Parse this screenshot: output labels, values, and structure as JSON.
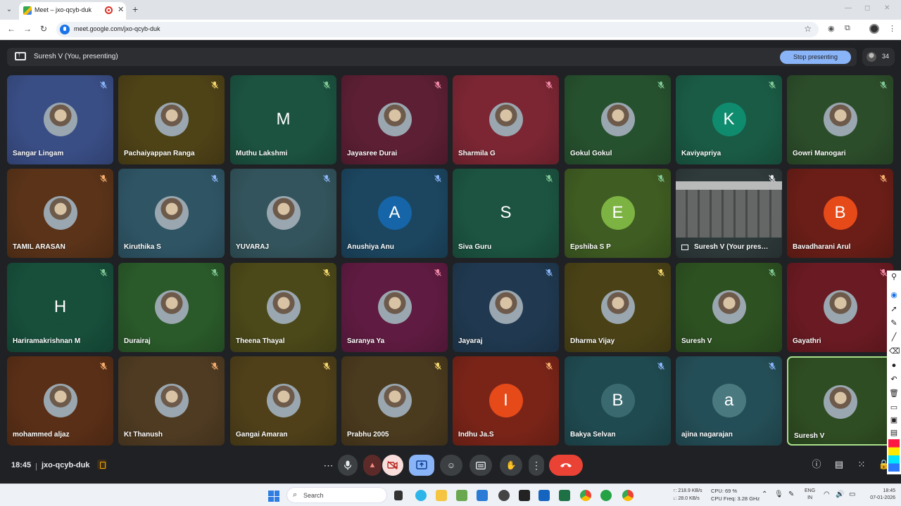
{
  "browser": {
    "tab_title": "Meet – jxo-qcyb-duk",
    "url": "meet.google.com/jxo-qcyb-duk"
  },
  "meet": {
    "presenting_label": "Suresh V (You, presenting)",
    "stop_presenting_label": "Stop presenting",
    "participant_count": "34",
    "time": "18:45",
    "room_code": "jxo-qcyb-duk",
    "accent_color": "#8ab4f8",
    "leave_color": "#ea4335"
  },
  "participants": [
    {
      "name": "Sangar Lingam",
      "bg": "#3a4e86",
      "avatar": "photo",
      "mic": "blue"
    },
    {
      "name": "Pachaiyappan Ranga",
      "bg": "#4e4217",
      "avatar": "photo",
      "mic": "yellow"
    },
    {
      "name": "Muthu Lakshmi",
      "bg": "#1c5340",
      "avatar": "M",
      "avatar_bg": "#1c5340",
      "mic": "green"
    },
    {
      "name": "Jayasree Durai",
      "bg": "#5c1f33",
      "avatar": "photo",
      "mic": "pink"
    },
    {
      "name": "Sharmila G",
      "bg": "#7c2633",
      "avatar": "photo",
      "mic": "pink"
    },
    {
      "name": "Gokul Gokul",
      "bg": "#26512e",
      "avatar": "photo",
      "mic": "green"
    },
    {
      "name": "Kaviyapriya",
      "bg": "#1a5b45",
      "avatar": "K",
      "avatar_bg": "#0f8b6e",
      "mic": "green"
    },
    {
      "name": "Gowri Manogari",
      "bg": "#2c4d2a",
      "avatar": "photo",
      "mic": "green"
    },
    {
      "name": "TAMIL ARASAN",
      "bg": "#5a3319",
      "avatar": "photo",
      "mic": "orange"
    },
    {
      "name": "Kiruthika S",
      "bg": "#2f5565",
      "avatar": "photo",
      "mic": "blue"
    },
    {
      "name": "YUVARAJ",
      "bg": "#33545c",
      "avatar": "photo",
      "mic": "blue"
    },
    {
      "name": "Anushiya Anu",
      "bg": "#1c4660",
      "avatar": "A",
      "avatar_bg": "#1565a8",
      "mic": "blue"
    },
    {
      "name": "Siva Guru",
      "bg": "#1c5441",
      "avatar": "S",
      "avatar_bg": "#1c5441",
      "mic": "green"
    },
    {
      "name": "Epshiba S P",
      "bg": "#3f5c22",
      "avatar": "E",
      "avatar_bg": "#7cb342",
      "mic": "green"
    },
    {
      "name": "Suresh V (Your pres…",
      "bg": "#2f3a3a",
      "avatar": "screen",
      "mic": "white"
    },
    {
      "name": "Bavadharani Arul",
      "bg": "#6a1e17",
      "avatar": "B",
      "avatar_bg": "#e64a19",
      "mic": "orange"
    },
    {
      "name": "Hariramakrishnan M",
      "bg": "#174f3b",
      "avatar": "H",
      "avatar_bg": "#174f3b",
      "mic": "green"
    },
    {
      "name": "Durairaj",
      "bg": "#2a5a2a",
      "avatar": "photo",
      "mic": "green"
    },
    {
      "name": "Theena Thayal",
      "bg": "#4b4919",
      "avatar": "photo",
      "mic": "yellow"
    },
    {
      "name": "Saranya Ya",
      "bg": "#5f1b41",
      "avatar": "photo",
      "mic": "pink"
    },
    {
      "name": "Jayaraj",
      "bg": "#203950",
      "avatar": "photo",
      "mic": "blue"
    },
    {
      "name": "Dharma Vijay",
      "bg": "#4a4216",
      "avatar": "photo",
      "mic": "yellow"
    },
    {
      "name": "Suresh V",
      "bg": "#2d5121",
      "avatar": "photo",
      "mic": "green"
    },
    {
      "name": "Gayathri",
      "bg": "#6a1a22",
      "avatar": "photo",
      "mic": "pink"
    },
    {
      "name": "mohammed aljaz",
      "bg": "#5a2f17",
      "avatar": "photo",
      "mic": "orange"
    },
    {
      "name": "Kt Thanush",
      "bg": "#4f3b22",
      "avatar": "photo",
      "mic": "orange"
    },
    {
      "name": "Gangai Amaran",
      "bg": "#4f4019",
      "avatar": "photo",
      "mic": "yellow"
    },
    {
      "name": "Prabhu 2005",
      "bg": "#4a3a1e",
      "avatar": "photo",
      "mic": "yellow"
    },
    {
      "name": "Indhu Ja.S",
      "bg": "#7a2418",
      "avatar": "I",
      "avatar_bg": "#e64a19",
      "mic": "orange"
    },
    {
      "name": "Bakya Selvan",
      "bg": "#1f4a50",
      "avatar": "B",
      "avatar_bg": "#3a6a70",
      "mic": "blue"
    },
    {
      "name": "ajina nagarajan",
      "bg": "#244e57",
      "avatar": "a",
      "avatar_bg": "#4a7a80",
      "mic": "blue"
    },
    {
      "name": "Suresh V",
      "bg": "#2f4d22",
      "avatar": "photo",
      "mic": "none",
      "speaking": true
    }
  ],
  "taskbar": {
    "search_placeholder": "Search",
    "net_up": "↑: 218.9 KB/s",
    "net_down": "↓: 28.0 KB/s",
    "cpu": "CPU: 69 %",
    "cpu_freq": "CPU Freq: 3.28 GHz",
    "lang1": "ENG",
    "lang2": "IN",
    "clock_time": "18:45",
    "clock_date": "07-01-2026"
  }
}
